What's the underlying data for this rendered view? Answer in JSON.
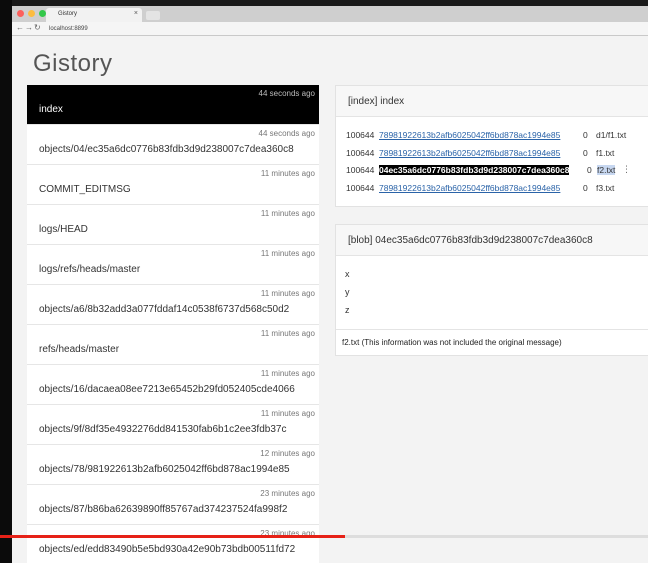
{
  "browser": {
    "tab_title": "Gistory",
    "url": "localhost:8899",
    "back_icon": "←",
    "forward_icon": "→",
    "reload_icon": "↻"
  },
  "app": {
    "title": "Gistory"
  },
  "history": [
    {
      "time": "44 seconds ago",
      "name": "index",
      "active": true
    },
    {
      "time": "44 seconds ago",
      "name": "objects/04/ec35a6dc0776b83fdb3d9d238007c7dea360c8"
    },
    {
      "time": "11 minutes ago",
      "name": "COMMIT_EDITMSG"
    },
    {
      "time": "11 minutes ago",
      "name": "logs/HEAD"
    },
    {
      "time": "11 minutes ago",
      "name": "logs/refs/heads/master"
    },
    {
      "time": "11 minutes ago",
      "name": "objects/a6/8b32add3a077fddaf14c0538f6737d568c50d2"
    },
    {
      "time": "11 minutes ago",
      "name": "refs/heads/master"
    },
    {
      "time": "11 minutes ago",
      "name": "objects/16/dacaea08ee7213e65452b29fd052405cde4066"
    },
    {
      "time": "11 minutes ago",
      "name": "objects/9f/8df35e4932276dd841530fab6b1c2ee3fdb37c"
    },
    {
      "time": "12 minutes ago",
      "name": "objects/78/981922613b2afb6025042ff6bd878ac1994e85"
    },
    {
      "time": "23 minutes ago",
      "name": "objects/87/b86ba62639890ff85767ad374237524fa998f2"
    },
    {
      "time": "23 minutes ago",
      "name": "objects/ed/edd83490b5e5bd930a42e90b73bdb00511fd72"
    }
  ],
  "index_panel": {
    "header": "[index] index",
    "entries": [
      {
        "mode": "100644",
        "hash": "78981922613b2afb6025042ff6bd878ac1994e85",
        "stage": "0",
        "path": "d1/f1.txt"
      },
      {
        "mode": "100644",
        "hash": "78981922613b2afb6025042ff6bd878ac1994e85",
        "stage": "0",
        "path": "f1.txt"
      },
      {
        "mode": "100644",
        "hash": "04ec35a6dc0776b83fdb3d9d238007c7dea360c8",
        "stage": "0",
        "path": "f2.txt",
        "selected": true
      },
      {
        "mode": "100644",
        "hash": "78981922613b2afb6025042ff6bd878ac1994e85",
        "stage": "0",
        "path": "f3.txt"
      }
    ]
  },
  "blob_panel": {
    "header": "[blob] 04ec35a6dc0776b83fdb3d9d238007c7dea360c8",
    "lines": [
      "x",
      "y",
      "z"
    ],
    "footer": "f2.txt (This information was not included the original message)"
  },
  "video": {
    "progress": 0.532
  },
  "colors": {
    "accent_link": "#2a63a8",
    "active_item": "#000000",
    "progress": "#e62117"
  }
}
